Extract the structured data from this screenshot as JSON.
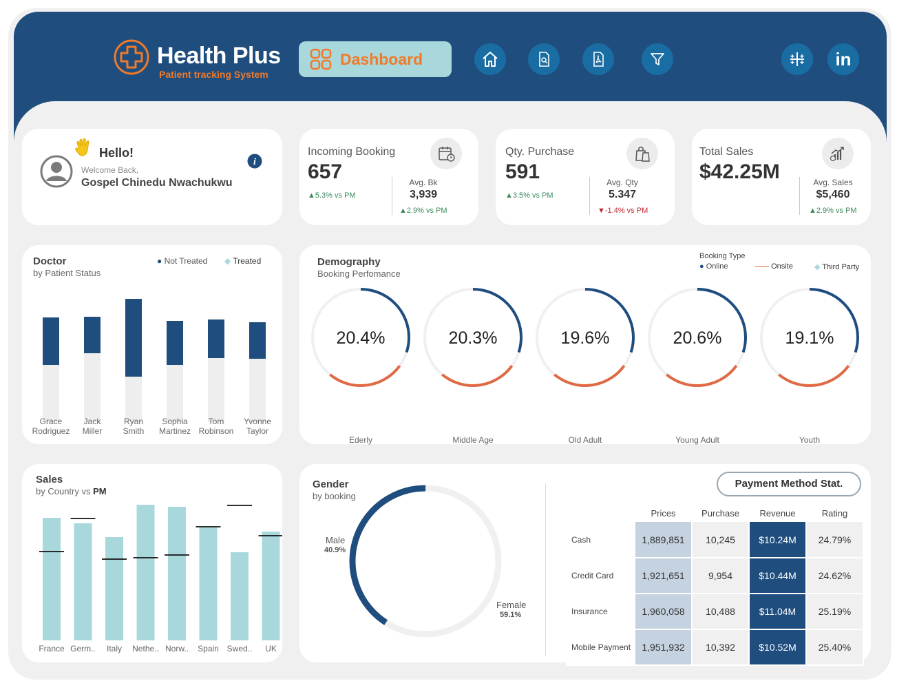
{
  "brand": {
    "name": "Health Plus",
    "tagline": "Patient tracking System"
  },
  "nav": {
    "dashboard_label": "Dashboard",
    "icons": [
      "home-icon",
      "report-icon",
      "pdf-icon",
      "filter-icon",
      "tableau-icon",
      "linkedin-icon"
    ],
    "linkedin_text": "in"
  },
  "welcome": {
    "greeting": "Hello!",
    "welcome_text": "Welcome Back,",
    "user_name": "Gospel Chinedu Nwachukwu"
  },
  "kpis": {
    "incoming": {
      "title": "Incoming Booking",
      "value": "657",
      "change": "▲5.3% vs PM",
      "sub_label": "Avg. Bk",
      "sub_value": "3,939",
      "sub_change": "▲2.9% vs PM"
    },
    "qty": {
      "title": "Qty. Purchase",
      "value": "591",
      "change": "▲3.5% vs PM",
      "sub_label": "Avg. Qty",
      "sub_value": "5.347",
      "sub_change": "▼-1.4% vs PM"
    },
    "sales": {
      "title": "Total Sales",
      "value": "$42.25M",
      "sub_label": "Avg. Sales",
      "sub_value": "$5,460",
      "sub_change": "▲2.9% vs PM"
    }
  },
  "doctor": {
    "title": "Doctor",
    "subtitle": "by Patient Status",
    "legend": {
      "not_treated": "Not Treated",
      "treated": "Treated"
    },
    "labels": [
      [
        "Grace",
        "Rodriguez"
      ],
      [
        "Jack",
        "Miller"
      ],
      [
        "Ryan",
        "Smith"
      ],
      [
        "Sophia",
        "Martinez"
      ],
      [
        "Tom",
        "Robinson"
      ],
      [
        "Yvonne",
        "Taylor"
      ]
    ]
  },
  "demography": {
    "title": "Demography",
    "subtitle": "Booking Perfomance",
    "legend": {
      "title": "Booking Type",
      "online": "Online",
      "onsite": "Onsite",
      "third_party": "Third Party"
    },
    "groups": [
      {
        "label": "Ederly",
        "value": "20.4%"
      },
      {
        "label": "Middle Age",
        "value": "20.3%"
      },
      {
        "label": "Old Adult",
        "value": "19.6%"
      },
      {
        "label": "Young Adult",
        "value": "20.6%"
      },
      {
        "label": "Youth",
        "value": "19.1%"
      }
    ]
  },
  "sales_country": {
    "title": "Sales",
    "subtitle_prefix": "by Country vs ",
    "subtitle_bold": "PM"
  },
  "gender": {
    "title": "Gender",
    "subtitle": "by booking",
    "male_label": "Male",
    "male_value": "40.9%",
    "female_label": "Female",
    "female_value": "59.1%"
  },
  "payment": {
    "title": "Payment Method Stat.",
    "columns": [
      "Prices",
      "Purchase",
      "Revenue",
      "Rating"
    ],
    "rows": [
      {
        "method": "Cash",
        "prices": "1,889,851",
        "purchase": "10,245",
        "revenue": "$10.24M",
        "rating": "24.79%"
      },
      {
        "method": "Credit Card",
        "prices": "1,921,651",
        "purchase": "9,954",
        "revenue": "$10.44M",
        "rating": "24.62%"
      },
      {
        "method": "Insurance",
        "prices": "1,960,058",
        "purchase": "10,488",
        "revenue": "$11.04M",
        "rating": "25.19%"
      },
      {
        "method": "Mobile Payment",
        "prices": "1,951,932",
        "purchase": "10,392",
        "revenue": "$10.52M",
        "rating": "25.40%"
      }
    ]
  },
  "colors": {
    "navy": "#1e4d7e",
    "teal": "#a9d8dc",
    "orange": "#f07a2a",
    "light_grey": "#ececec"
  },
  "chart_data": [
    {
      "type": "bar",
      "title": "Doctor",
      "subtitle": "by Patient Status",
      "categories": [
        "Grace Rodriguez",
        "Jack Miller",
        "Ryan Smith",
        "Sophia Martinez",
        "Tom Robinson",
        "Yvonne Taylor"
      ],
      "series": [
        {
          "name": "Not Treated",
          "values": [
            69,
            53,
            113,
            64,
            56,
            53
          ]
        },
        {
          "name": "Treated",
          "values": [
            83,
            100,
            66,
            83,
            93,
            92
          ]
        }
      ],
      "stacked": true,
      "ylim": [
        0,
        180
      ],
      "legend": "top-right",
      "grid": false
    },
    {
      "type": "pie",
      "title": "Demography",
      "subtitle": "Booking Perfomance",
      "categories": [
        "Ederly",
        "Middle Age",
        "Old Adult",
        "Young Adult",
        "Youth"
      ],
      "values": [
        20.4,
        20.3,
        19.6,
        20.6,
        19.1
      ],
      "series": [
        {
          "name": "Online",
          "values": [
            0.3,
            0.3,
            0.3,
            0.3,
            0.3
          ]
        },
        {
          "name": "Onsite",
          "values": [
            0.26,
            0.26,
            0.26,
            0.26,
            0.26
          ]
        }
      ],
      "legend": "top-right"
    },
    {
      "type": "bar",
      "title": "Sales",
      "subtitle": "by Country vs PM",
      "categories": [
        "France",
        "Germ..",
        "Italy",
        "Nethe..",
        "Norw..",
        "Spain",
        "Swed..",
        "UK"
      ],
      "series": [
        {
          "name": "Current",
          "values": [
            178,
            170,
            150,
            197,
            194,
            164,
            128,
            158
          ]
        },
        {
          "name": "PM",
          "values": [
            129,
            177,
            118,
            120,
            124,
            165,
            196,
            152
          ]
        }
      ],
      "ylim": [
        0,
        210
      ],
      "grid": false
    },
    {
      "type": "pie",
      "title": "Gender",
      "subtitle": "by booking",
      "categories": [
        "Male",
        "Female"
      ],
      "values": [
        40.9,
        59.1
      ]
    },
    {
      "type": "table",
      "title": "Payment Method Stat.",
      "columns": [
        "Prices",
        "Purchase",
        "Revenue",
        "Rating"
      ],
      "rows": [
        "Cash",
        "Credit Card",
        "Insurance",
        "Mobile Payment"
      ],
      "values": [
        [
          "1,889,851",
          "10,245",
          "$10.24M",
          "24.79%"
        ],
        [
          "1,921,651",
          "9,954",
          "$10.44M",
          "24.62%"
        ],
        [
          "1,960,058",
          "10,488",
          "$11.04M",
          "25.19%"
        ],
        [
          "1,951,932",
          "10,392",
          "$10.52M",
          "25.40%"
        ]
      ]
    }
  ]
}
